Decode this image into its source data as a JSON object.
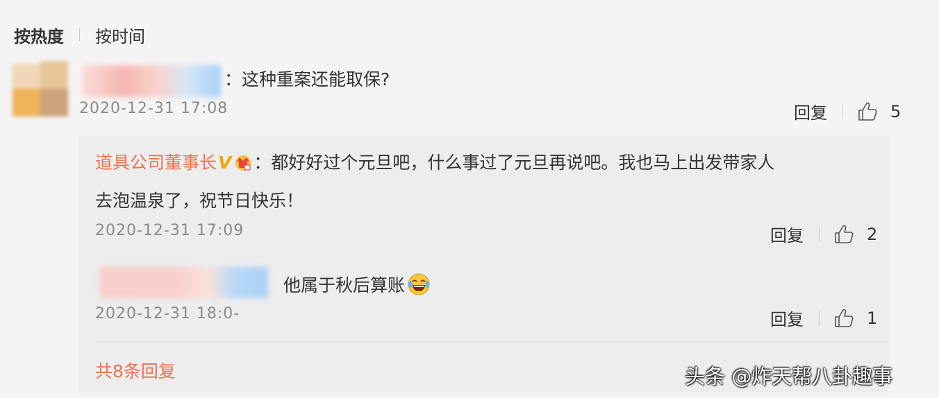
{
  "sort": {
    "by_hot": "按热度",
    "by_time": "按时间"
  },
  "comment": {
    "text": "：这种重案还能取保?",
    "time": "2020-12-31 17:08",
    "reply_label": "回复",
    "likes": "5"
  },
  "replies": [
    {
      "author": "道具公司董事长",
      "verified_badge": "V",
      "text_line1": "：都好好过个元旦吧，什么事过了元旦再说吧。我也马上出发带家人",
      "text_line2": "去泡温泉了，祝节日快乐！",
      "time": "2020-12-31 17:09",
      "reply_label": "回复",
      "likes": "2"
    },
    {
      "text": "他属于秋后算账",
      "time": "2020-12-31 18:0-",
      "reply_label": "回复",
      "likes": "1"
    }
  ],
  "more_replies": "共8条回复",
  "watermark": "头条 @炸天帮八卦趣事",
  "colors": {
    "accent": "#eb7350",
    "badge": "#f0a600",
    "background": "#f4f4f5",
    "reply_background": "#ededee"
  }
}
